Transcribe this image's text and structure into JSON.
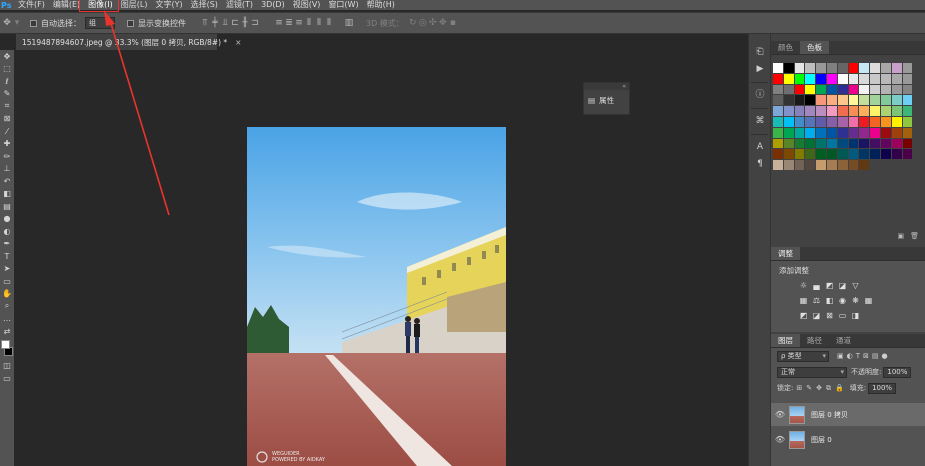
{
  "menubar": {
    "logo": "Ps",
    "items": [
      "文件(F)",
      "编辑(E)",
      "图像(I)",
      "图层(L)",
      "文字(Y)",
      "选择(S)",
      "滤镜(T)",
      "3D(D)",
      "视图(V)",
      "窗口(W)",
      "帮助(H)"
    ],
    "highlighted_index": 2
  },
  "options": {
    "auto_select_label": "自动选择：",
    "auto_select_value": "组",
    "transform_controls_label": "显示变换控件",
    "mode_3d_label": "3D 模式："
  },
  "document": {
    "tab_title": "1519487894607.jpeg @ 33.3% (图层 0 拷贝, RGB/8#) *",
    "close_glyph": "×",
    "watermark_line1": "WEGUIDER",
    "watermark_line2": "POWERED BY AIDKAY"
  },
  "properties_panel": {
    "collapse_glyph": "«",
    "label": "属性"
  },
  "swatches": {
    "tabs": [
      "颜色",
      "色板"
    ],
    "active_tab": 1,
    "rows": [
      [
        "#ffffff",
        "#000000",
        "#e6e6e6",
        "#bfbfbf",
        "#999999",
        "#808080",
        "#666666",
        "#ff0000",
        "#c6e7f4",
        "#dcdcdc",
        "#a8a8a8",
        "#c89fc8",
        "#9a9a9a"
      ],
      [
        "#ff0000",
        "#ffff00",
        "#00ff00",
        "#00ffff",
        "#0000ff",
        "#ff00ff",
        "#ffffff",
        "#e8e8e8",
        "#d9d9d9",
        "#c9c9c9",
        "#b9b9b9",
        "#a9a9a9",
        "#999999"
      ],
      [
        "#808080",
        "#6e6e6e",
        "#ff0000",
        "#ffff00",
        "#00a651",
        "#0054a6",
        "#2e3192",
        "#ec008c",
        "#f2f2f2",
        "#cfcfcf",
        "#b3b3b3",
        "#9a9a9a",
        "#858585"
      ],
      [
        "#5e5e5e",
        "#333333",
        "#1a1a1a",
        "#000000",
        "#f7977a",
        "#f9ad81",
        "#fdc68a",
        "#fff79a",
        "#c4df9b",
        "#a3d39c",
        "#82ca9c",
        "#7bcdc8",
        "#6dcff6"
      ],
      [
        "#7da7d9",
        "#8393ca",
        "#8781bd",
        "#a187be",
        "#bc8dbf",
        "#f49ac2",
        "#f26c4f",
        "#f68e55",
        "#fbaf5c",
        "#fff467",
        "#acd372",
        "#7cc576",
        "#3bb878"
      ],
      [
        "#1abbb4",
        "#00bff3",
        "#438ccb",
        "#5574b9",
        "#605ca8",
        "#855fa8",
        "#a763a8",
        "#f06eaa",
        "#ed1c24",
        "#f26522",
        "#f7941d",
        "#fff200",
        "#8dc63f"
      ],
      [
        "#39b54a",
        "#00a651",
        "#00a99d",
        "#00aeef",
        "#0072bc",
        "#0054a6",
        "#2e3192",
        "#662d91",
        "#92278f",
        "#ec008c",
        "#9e0b0f",
        "#a0410d",
        "#a36209"
      ],
      [
        "#aba000",
        "#598527",
        "#197b30",
        "#007236",
        "#00746b",
        "#0076a3",
        "#004a80",
        "#003471",
        "#1b1464",
        "#440e62",
        "#630460",
        "#9e005d",
        "#790000"
      ],
      [
        "#7b2e00",
        "#7d4900",
        "#827b00",
        "#406618",
        "#005e20",
        "#005826",
        "#005952",
        "#005b7f",
        "#003663",
        "#002157",
        "#0d004c",
        "#32004b",
        "#4b0049"
      ],
      [
        "#c7b299",
        "#998675",
        "#736357",
        "#534741",
        "#c69c6d",
        "#a67c52",
        "#8c6239",
        "#754c24",
        "#603913"
      ]
    ]
  },
  "adjustments": {
    "title": "调整",
    "subtitle": "添加调整"
  },
  "layers": {
    "tabs": [
      "图层",
      "路径",
      "通道"
    ],
    "active_tab": 0,
    "filter_value": "ρ 类型",
    "blend_mode": "正常",
    "opacity_label": "不透明度:",
    "opacity_value": "100%",
    "lock_label": "锁定:",
    "fill_label": "填充:",
    "fill_value": "100%",
    "items": [
      {
        "name": "图层 0 拷贝",
        "selected": true
      },
      {
        "name": "图层 0",
        "selected": false
      }
    ]
  },
  "colors": {
    "annotation_red": "#e8342c",
    "ps_blue": "#31a8ff"
  }
}
